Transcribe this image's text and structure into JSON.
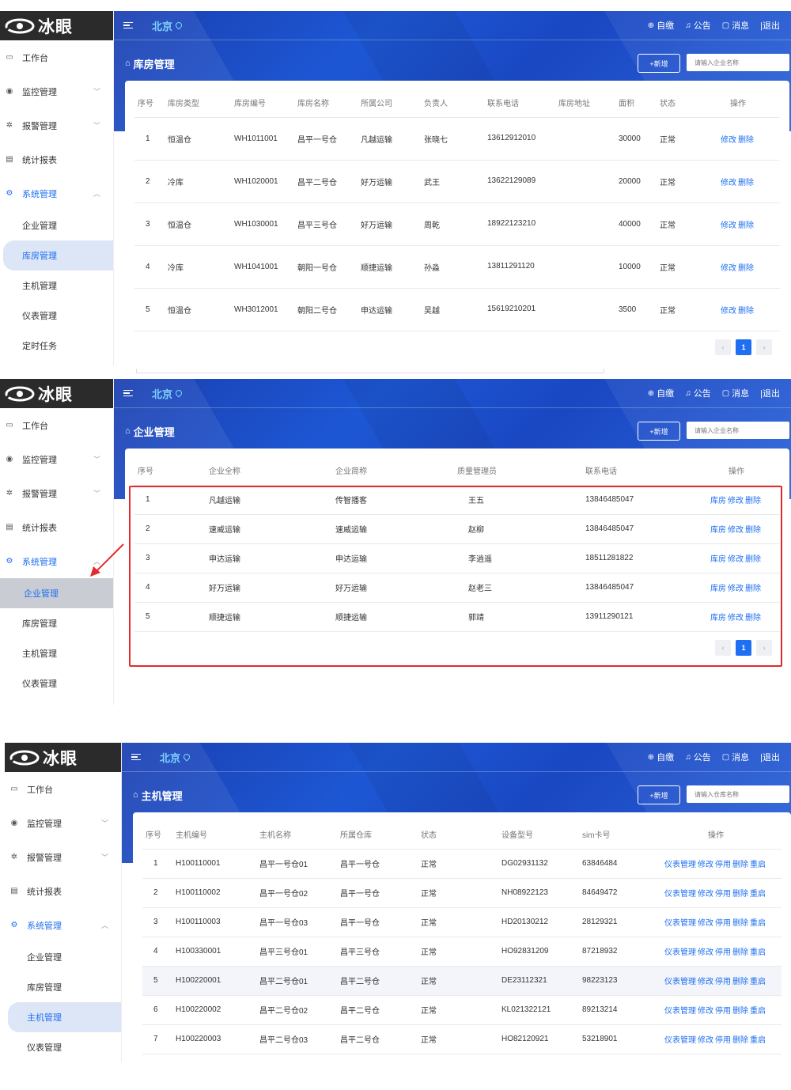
{
  "brand": {
    "name": "冰眼"
  },
  "topbar": {
    "city": "北京",
    "tools": [
      "自缴",
      "公告",
      "消息",
      "|退出"
    ]
  },
  "sidebar": {
    "items": [
      {
        "label": "工作台",
        "icon": "monitor-icon"
      },
      {
        "label": "监控管理",
        "icon": "location-icon",
        "has_children": true
      },
      {
        "label": "报警管理",
        "icon": "alarm-icon",
        "has_children": true
      },
      {
        "label": "统计报表",
        "icon": "report-icon"
      },
      {
        "label": "系统管理",
        "icon": "settings-icon",
        "has_children": true,
        "open": true
      }
    ]
  },
  "panel1": {
    "sub_items": [
      "企业管理",
      "库房管理",
      "主机管理",
      "仪表管理",
      "定时任务"
    ],
    "active_sub": "库房管理",
    "title": "库房管理",
    "new_label": "+新增",
    "search_placeholder": "请输入企业名称",
    "columns": [
      "序号",
      "库房类型",
      "库房编号",
      "库房名称",
      "所属公司",
      "负责人",
      "联系电话",
      "库房地址",
      "面积",
      "状态",
      "操作"
    ],
    "rows": [
      {
        "no": "1",
        "type": "恒温仓",
        "code": "WH1011001",
        "name": "昌平一号仓",
        "company": "凡越运输",
        "owner": "张晓七",
        "phone": "13612912010",
        "address": "",
        "area": "30000",
        "status": "正常"
      },
      {
        "no": "2",
        "type": "冷库",
        "code": "WH1020001",
        "name": "昌平二号仓",
        "company": "好万运输",
        "owner": "武王",
        "phone": "13622129089",
        "address": "",
        "area": "20000",
        "status": "正常"
      },
      {
        "no": "3",
        "type": "恒温仓",
        "code": "WH1030001",
        "name": "昌平三号仓",
        "company": "好万运输",
        "owner": "周乾",
        "phone": "18922123210",
        "address": "",
        "area": "40000",
        "status": "正常"
      },
      {
        "no": "4",
        "type": "冷库",
        "code": "WH1041001",
        "name": "朝阳一号仓",
        "company": "顺捷运输",
        "owner": "孙淼",
        "phone": "13811291120",
        "address": "",
        "area": "10000",
        "status": "正常"
      },
      {
        "no": "5",
        "type": "恒温仓",
        "code": "WH3012001",
        "name": "朝阳二号仓",
        "company": "申达运输",
        "owner": "吴越",
        "phone": "15619210201",
        "address": "",
        "area": "3500",
        "status": "正常"
      }
    ],
    "ops": [
      "修改",
      "删除"
    ],
    "page": "1"
  },
  "panel2": {
    "sub_items": [
      "企业管理",
      "库房管理",
      "主机管理",
      "仪表管理"
    ],
    "active_sub": "企业管理",
    "title": "企业管理",
    "new_label": "+新增",
    "search_placeholder": "请输入企业名称",
    "columns": [
      "序号",
      "企业全称",
      "企业简称",
      "质量管理员",
      "联系电话",
      "操作"
    ],
    "rows": [
      {
        "no": "1",
        "full": "凡越运输",
        "short": "传智播客",
        "manager": "王五",
        "phone": "13846485047"
      },
      {
        "no": "2",
        "full": "速威运输",
        "short": "速威运输",
        "manager": "赵柳",
        "phone": "13846485047"
      },
      {
        "no": "3",
        "full": "申达运输",
        "short": "申达运输",
        "manager": "李逍遥",
        "phone": "18511281822"
      },
      {
        "no": "4",
        "full": "好万运输",
        "short": "好万运输",
        "manager": "赵老三",
        "phone": "13846485047"
      },
      {
        "no": "5",
        "full": "顺捷运输",
        "short": "顺捷运输",
        "manager": "郭靖",
        "phone": "13911290121"
      }
    ],
    "ops": [
      "库房",
      "修改",
      "删除"
    ],
    "page": "1"
  },
  "panel3": {
    "sub_items": [
      "企业管理",
      "库房管理",
      "主机管理",
      "仪表管理"
    ],
    "active_sub": "主机管理",
    "title": "主机管理",
    "new_label": "+新增",
    "search_placeholder": "请输入仓库名称",
    "columns": [
      "序号",
      "主机编号",
      "主机名称",
      "所属仓库",
      "状态",
      "设备型号",
      "sim卡号",
      "操作"
    ],
    "rows": [
      {
        "no": "1",
        "code": "H100110001",
        "name": "昌平一号仓01",
        "store": "昌平一号仓",
        "status": "正常",
        "model": "DG02931132",
        "sim": "63846484"
      },
      {
        "no": "2",
        "code": "H100110002",
        "name": "昌平一号仓02",
        "store": "昌平一号仓",
        "status": "正常",
        "model": "NH08922123",
        "sim": "84649472"
      },
      {
        "no": "3",
        "code": "H100110003",
        "name": "昌平一号仓03",
        "store": "昌平一号仓",
        "status": "正常",
        "model": "HD20130212",
        "sim": "28129321"
      },
      {
        "no": "4",
        "code": "H100330001",
        "name": "昌平三号仓01",
        "store": "昌平三号仓",
        "status": "正常",
        "model": "HO92831209",
        "sim": "87218932"
      },
      {
        "no": "5",
        "code": "H100220001",
        "name": "昌平二号仓01",
        "store": "昌平二号仓",
        "status": "正常",
        "model": "DE23112321",
        "sim": "98223123"
      },
      {
        "no": "6",
        "code": "H100220002",
        "name": "昌平二号仓02",
        "store": "昌平二号仓",
        "status": "正常",
        "model": "KL021322121",
        "sim": "89213214"
      },
      {
        "no": "7",
        "code": "H100220003",
        "name": "昌平二号仓03",
        "store": "昌平二号仓",
        "status": "正常",
        "model": "HO82120921",
        "sim": "53218901"
      }
    ],
    "ops": [
      "仪表管理",
      "修改",
      "停用",
      "删除",
      "重启"
    ]
  },
  "colors": {
    "brand_dark": "#2b2b2b",
    "accent": "#1e6ff2",
    "hero": "#1d57d4",
    "highlight": "#e32b2b"
  }
}
